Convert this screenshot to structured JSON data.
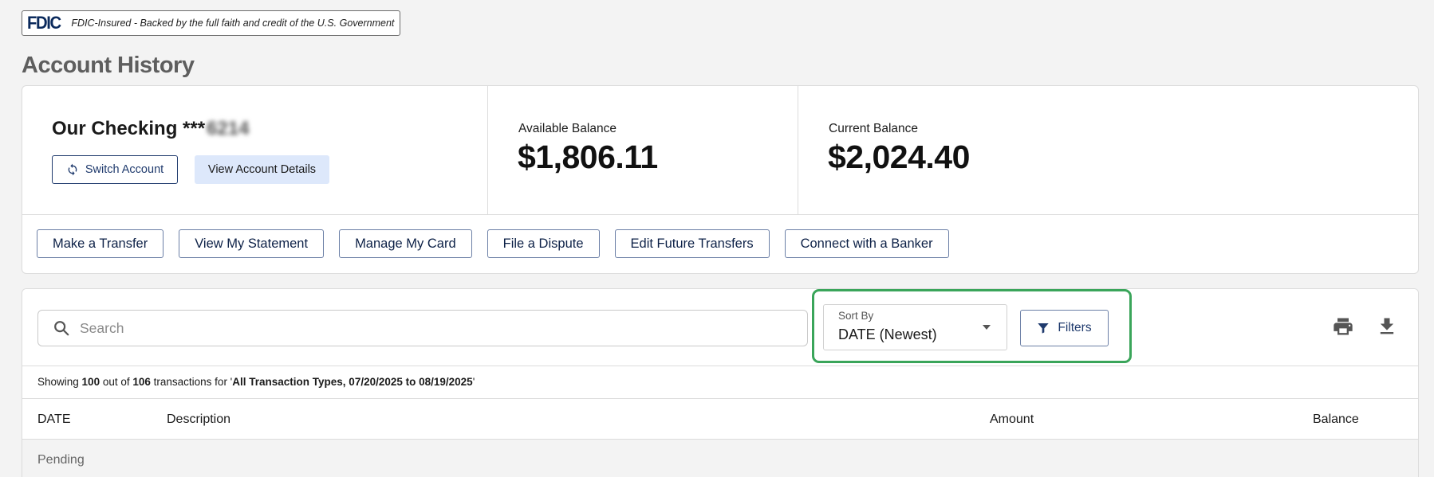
{
  "fdic": {
    "logo": "FDIC",
    "text": "FDIC-Insured - Backed by the full faith and credit of the U.S. Government"
  },
  "page": {
    "title": "Account History"
  },
  "account": {
    "name_prefix": "Our Checking ***",
    "name_masked": "6214",
    "switch_label": "Switch Account",
    "details_label": "View Account Details",
    "available_label": "Available Balance",
    "available_value": "$1,806.11",
    "current_label": "Current Balance",
    "current_value": "$2,024.40"
  },
  "actions": [
    {
      "label": "Make a Transfer"
    },
    {
      "label": "View My Statement"
    },
    {
      "label": "Manage My Card"
    },
    {
      "label": "File a Dispute"
    },
    {
      "label": "Edit Future Transfers"
    },
    {
      "label": "Connect with a Banker"
    }
  ],
  "toolbar": {
    "search_placeholder": "Search",
    "sort_label": "Sort By",
    "sort_value": "DATE (Newest)",
    "filters_label": "Filters",
    "highlight_color": "#3aa55a"
  },
  "summary": {
    "showing": "Showing ",
    "count": "100",
    "out_of": " out of ",
    "total": "106",
    "for_text": " transactions for '",
    "criteria": "All Transaction Types, 07/20/2025 to 08/19/2025",
    "end": "'"
  },
  "table": {
    "headers": {
      "date": "DATE",
      "description": "Description",
      "amount": "Amount",
      "balance": "Balance"
    },
    "sections": [
      {
        "label": "Pending"
      }
    ]
  },
  "icons": {
    "switch": "refresh-icon",
    "search": "search-icon",
    "filter": "filter-icon",
    "print": "print-icon",
    "download": "download-icon",
    "caret": "chevron-down-icon"
  }
}
